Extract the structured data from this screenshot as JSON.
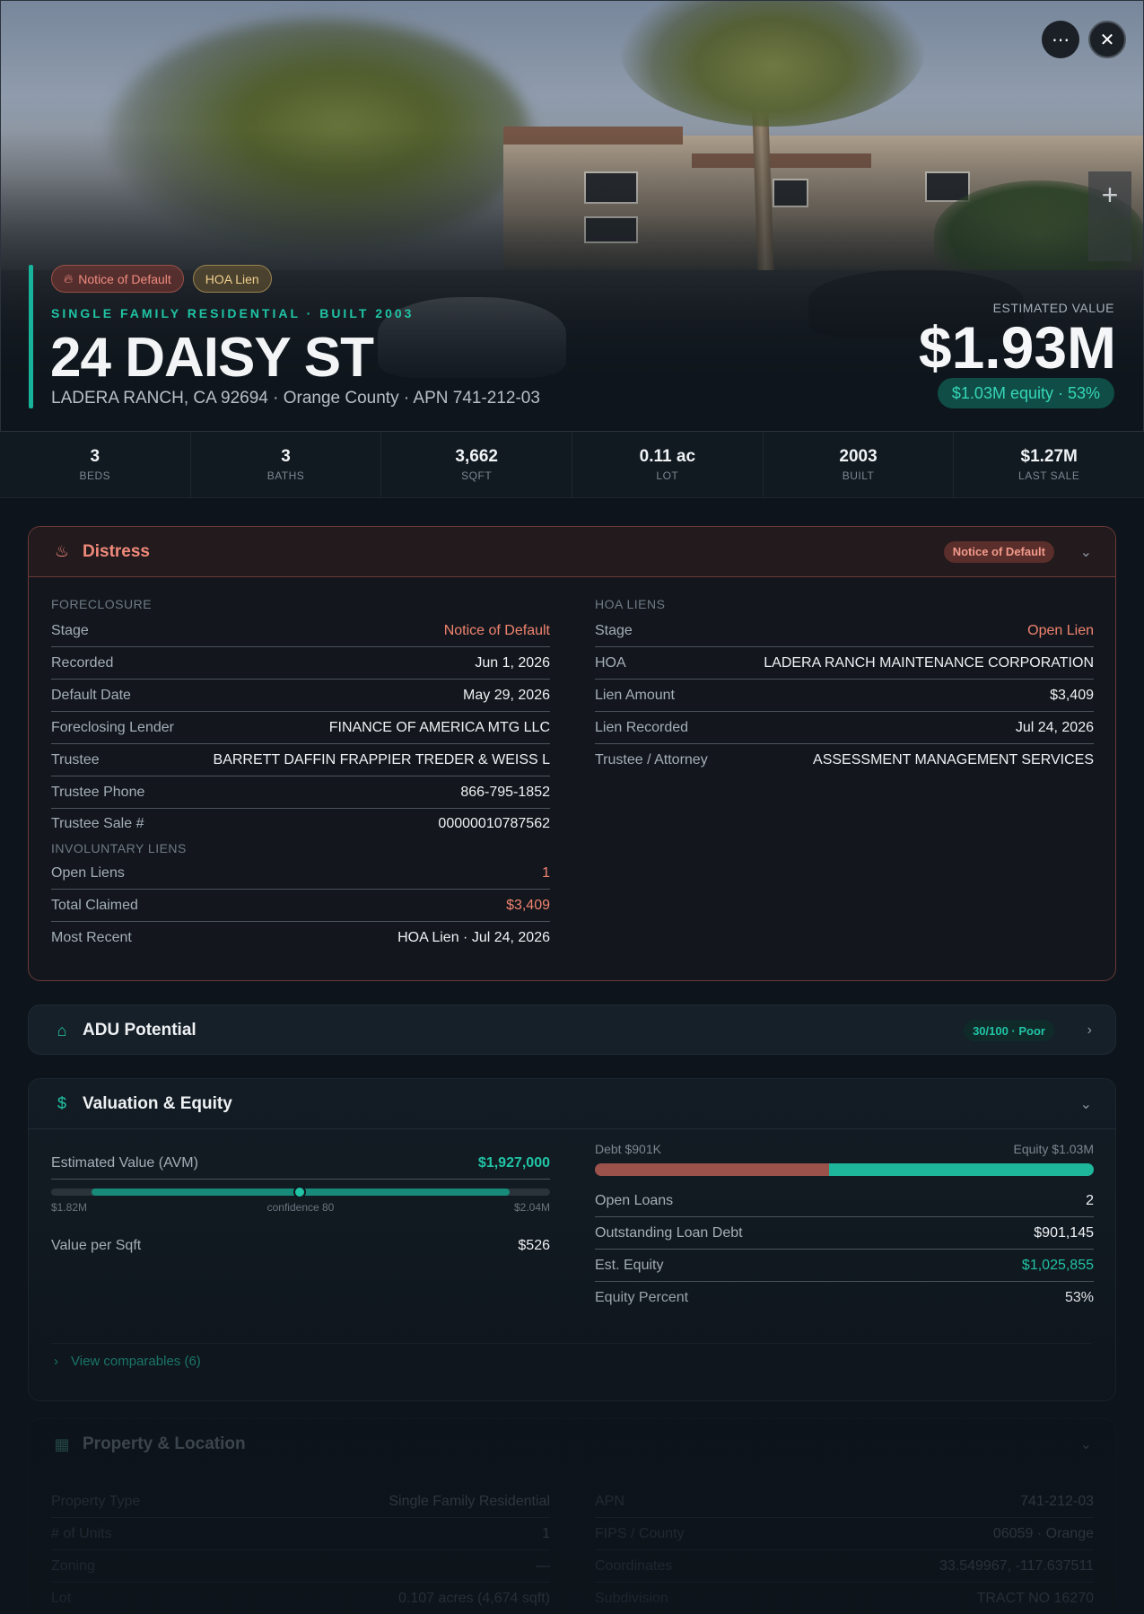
{
  "hero": {
    "tags": [
      "Notice of Default",
      "HOA Lien"
    ],
    "subtitle": "SINGLE FAMILY RESIDENTIAL · BUILT 2003",
    "address": "24 DAISY ST",
    "locality": "LADERA RANCH, CA 92694 · Orange County · APN 741-212-03",
    "estimated_label": "ESTIMATED VALUE",
    "estimated_value": "$1.93M",
    "equity_pill": "$1.03M equity · 53%"
  },
  "stats": [
    {
      "value": "3",
      "label": "BEDS"
    },
    {
      "value": "3",
      "label": "BATHS"
    },
    {
      "value": "3,662",
      "label": "SQFT"
    },
    {
      "value": "0.11 ac",
      "label": "LOT"
    },
    {
      "value": "2003",
      "label": "BUILT"
    },
    {
      "value": "$1.27M",
      "label": "LAST SALE"
    }
  ],
  "distress": {
    "title": "Distress",
    "badge": "Notice of Default",
    "foreclosure_label": "FORECLOSURE",
    "foreclosure": [
      {
        "k": "Stage",
        "v": "Notice of Default"
      },
      {
        "k": "Recorded",
        "v": "Jun 1, 2026"
      },
      {
        "k": "Default Date",
        "v": "May 29, 2026"
      },
      {
        "k": "Foreclosing Lender",
        "v": "FINANCE OF AMERICA MTG LLC"
      },
      {
        "k": "Trustee",
        "v": "BARRETT DAFFIN FRAPPIER TREDER & WEISS L"
      },
      {
        "k": "Trustee Phone",
        "v": "866-795-1852"
      },
      {
        "k": "Trustee Sale #",
        "v": "00000010787562"
      }
    ],
    "involuntary_label": "INVOLUNTARY LIENS",
    "involuntary": [
      {
        "k": "Open Liens",
        "v": "1"
      },
      {
        "k": "Total Claimed",
        "v": "$3,409"
      },
      {
        "k": "Most Recent",
        "v": "HOA Lien · Jul 24, 2026"
      }
    ],
    "hoa_label": "HOA LIENS",
    "hoa": [
      {
        "k": "Stage",
        "v": "Open Lien"
      },
      {
        "k": "HOA",
        "v": "LADERA RANCH MAINTENANCE CORPORATION"
      },
      {
        "k": "Lien Amount",
        "v": "$3,409"
      },
      {
        "k": "Lien Recorded",
        "v": "Jul 24, 2026"
      },
      {
        "k": "Trustee / Attorney",
        "v": "ASSESSMENT MANAGEMENT SERVICES"
      }
    ]
  },
  "adu": {
    "title": "ADU Potential",
    "badge": "30/100 · Poor",
    "score": 30
  },
  "valuation": {
    "title": "Valuation & Equity",
    "avm_label": "Estimated Value (AVM)",
    "avm_value": "$1,927,000",
    "range_low": "$1.82M",
    "range_high": "$2.04M",
    "confidence": "confidence 80",
    "value_per_sqft_label": "Value per Sqft",
    "value_per_sqft": "$526",
    "debt_label": "Debt $901K",
    "equity_label": "Equity $1.03M",
    "equity_fraction": 0.53,
    "rows": [
      {
        "k": "Open Loans",
        "v": "2"
      },
      {
        "k": "Outstanding Loan Debt",
        "v": "$901,145"
      },
      {
        "k": "Est. Equity",
        "v": "$1,025,855"
      },
      {
        "k": "Equity Percent",
        "v": "53%"
      }
    ],
    "comparables_link": "View comparables (6)"
  },
  "property": {
    "title": "Property & Location",
    "left": [
      {
        "k": "Property Type",
        "v": "Single Family Residential"
      },
      {
        "k": "# of Units",
        "v": "1"
      },
      {
        "k": "Zoning",
        "v": "—"
      },
      {
        "k": "Lot",
        "v": "0.107 acres (4,674 sqft)"
      }
    ],
    "right": [
      {
        "k": "APN",
        "v": "741-212-03"
      },
      {
        "k": "FIPS / County",
        "v": "06059 · Orange"
      },
      {
        "k": "Coordinates",
        "v": "33.549967, -117.637511"
      },
      {
        "k": "Subdivision",
        "v": "TRACT NO 16270"
      }
    ]
  },
  "colors": {
    "accent": "#21c4a5",
    "distress": "#f08a7a",
    "debt": "#9a524b"
  }
}
